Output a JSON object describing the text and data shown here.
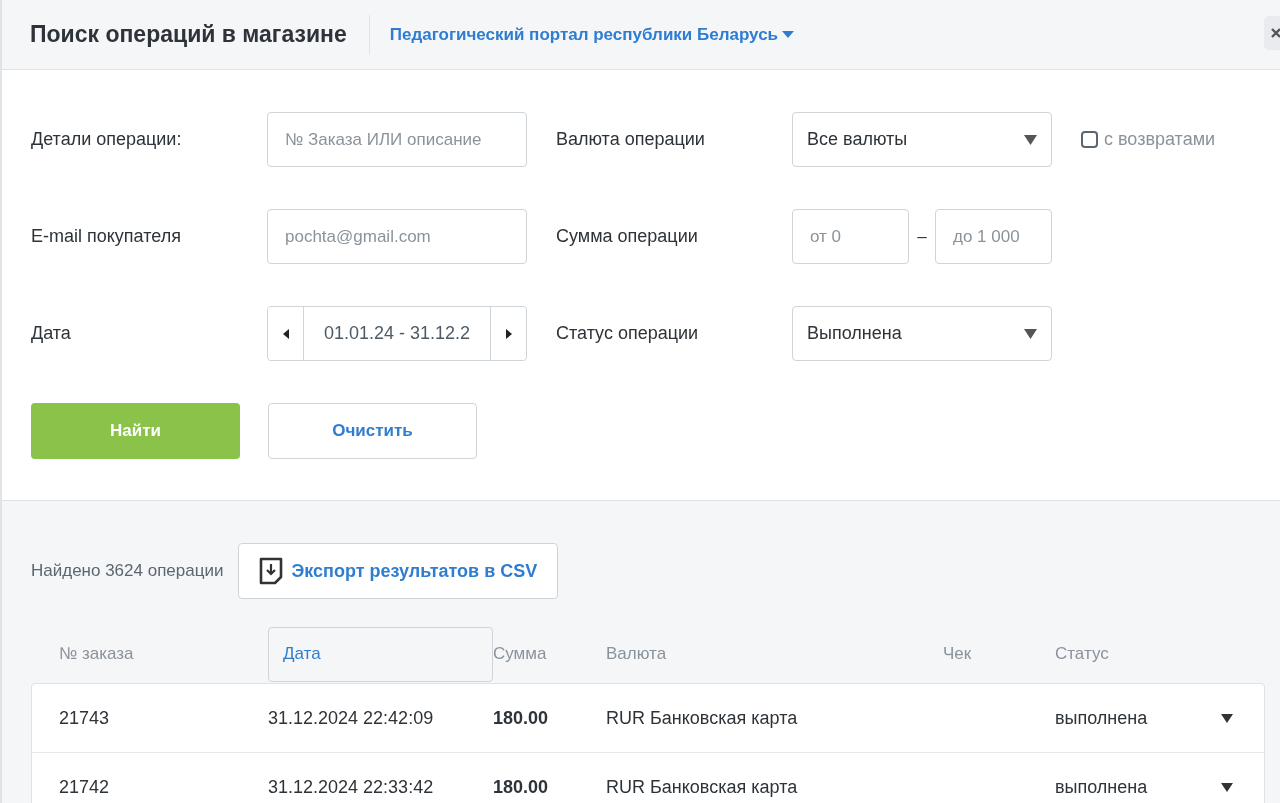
{
  "header": {
    "title": "Поиск операций в магазине",
    "site_selector": "Педагогический портал республики Беларусь"
  },
  "filters": {
    "order_details": {
      "label": "Детали операции:",
      "placeholder": "№ Заказа ИЛИ описание"
    },
    "currency": {
      "label": "Валюта операции",
      "value": "Все валюты"
    },
    "with_refunds": {
      "label": "с возвратами",
      "checked": false
    },
    "email": {
      "label": "E-mail покупателя",
      "placeholder": "pochta@gmail.com"
    },
    "amount": {
      "label": "Сумма операции",
      "from_placeholder": "от 0",
      "separator": "–",
      "to_placeholder": "до 1 000"
    },
    "date": {
      "label": "Дата",
      "value": "01.01.24 - 31.12.2"
    },
    "status": {
      "label": "Статус операции",
      "value": "Выполнена"
    }
  },
  "buttons": {
    "find": "Найти",
    "clear": "Очистить"
  },
  "results": {
    "count_text": "Найдено 3624 операции",
    "export_label": "Экспорт результатов в CSV"
  },
  "table": {
    "columns": [
      {
        "label": "№ заказа",
        "selected": false
      },
      {
        "label": "Дата",
        "selected": true
      },
      {
        "label": "Сумма",
        "selected": false
      },
      {
        "label": "Валюта",
        "selected": false
      },
      {
        "label": "Чек",
        "selected": false
      },
      {
        "label": "Статус",
        "selected": false
      }
    ],
    "rows": [
      {
        "order": "21743",
        "date": "31.12.2024 22:42:09",
        "amount": "180.00",
        "currency": "RUR Банковская карта",
        "status": "выполнена"
      },
      {
        "order": "21742",
        "date": "31.12.2024 22:33:42",
        "amount": "180.00",
        "currency": "RUR Банковская карта",
        "status": "выполнена"
      }
    ]
  }
}
